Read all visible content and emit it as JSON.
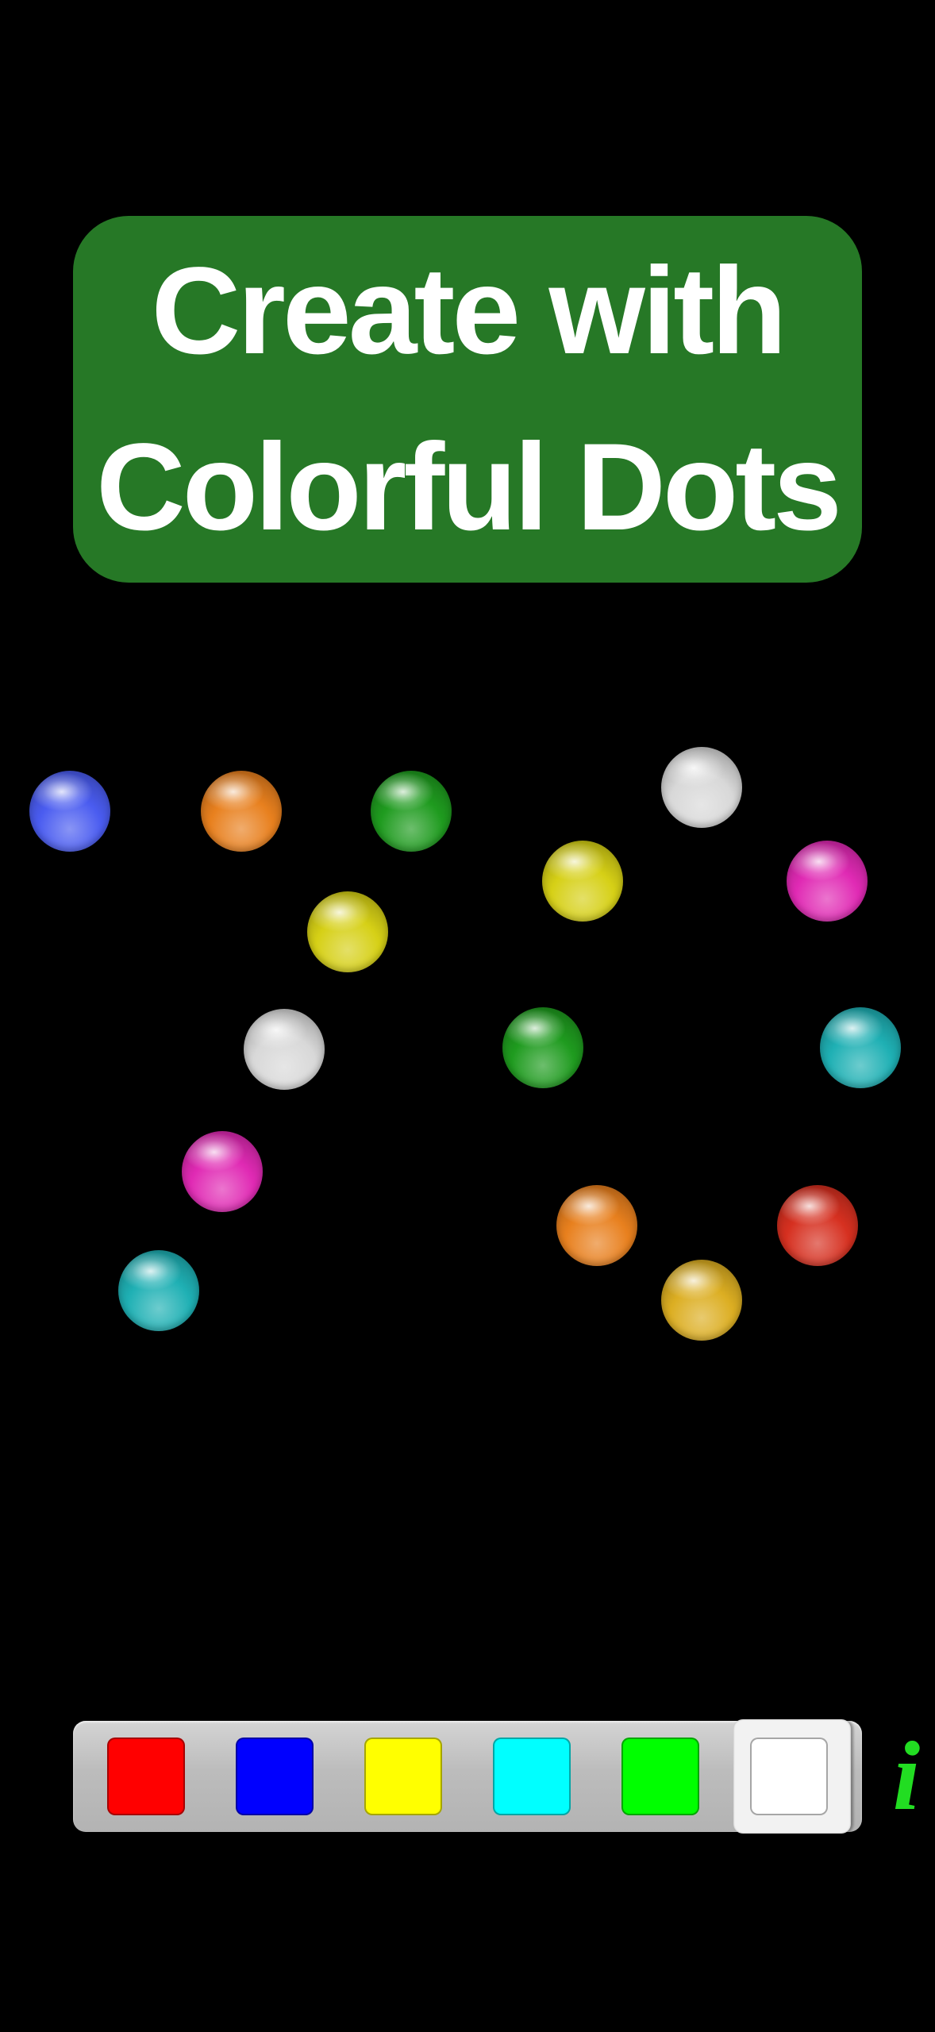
{
  "title": {
    "line1": "Create with",
    "line2": "Colorful Dots",
    "background_color": "#267826",
    "text_color": "#ffffff"
  },
  "dots": [
    {
      "color": "blue",
      "hex": "#4a5cf0"
    },
    {
      "color": "orange",
      "hex": "#e8801e"
    },
    {
      "color": "green",
      "hex": "#1f9b1f"
    },
    {
      "color": "white",
      "hex": "#d8d8d8"
    },
    {
      "color": "yellow",
      "hex": "#d6d016"
    },
    {
      "color": "magenta",
      "hex": "#e02ab4"
    },
    {
      "color": "yellow",
      "hex": "#d6d016"
    },
    {
      "color": "white",
      "hex": "#d8d8d8"
    },
    {
      "color": "green",
      "hex": "#1f9b1f"
    },
    {
      "color": "cyan",
      "hex": "#1fb0b4"
    },
    {
      "color": "magenta",
      "hex": "#e02ab4"
    },
    {
      "color": "orange",
      "hex": "#e8801e"
    },
    {
      "color": "red",
      "hex": "#d63020"
    },
    {
      "color": "cyan",
      "hex": "#1fb0b4"
    },
    {
      "color": "gold",
      "hex": "#dcae22"
    }
  ],
  "palette": {
    "swatches": [
      {
        "name": "red",
        "hex": "#ff0000"
      },
      {
        "name": "blue",
        "hex": "#0000ff"
      },
      {
        "name": "yellow",
        "hex": "#ffff00"
      },
      {
        "name": "cyan",
        "hex": "#00ffff"
      },
      {
        "name": "green",
        "hex": "#00ff00"
      },
      {
        "name": "white",
        "hex": "#ffffff"
      }
    ],
    "selected": "white"
  },
  "info_button": {
    "label": "i",
    "icon": "info-icon",
    "color": "#22dd22"
  }
}
